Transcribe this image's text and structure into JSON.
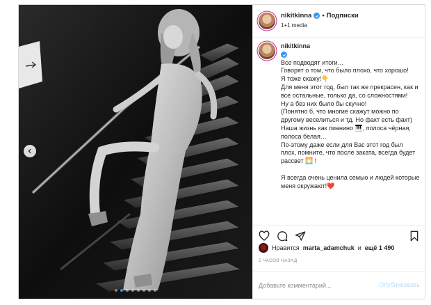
{
  "post": {
    "username": "nikitkinna",
    "follow_label": "Подписки",
    "separator": "•",
    "media_info": "1+1 media",
    "caption_lines": [
      "Все подводят итоги…",
      "Говорят о том, что было плохо, что хорошо!",
      "Я тоже скажу!👇",
      "Для меня этот год, был так же прекрасен, как и все остальные, только да, со сложностями!",
      "Ну а без них было бы скучно!",
      "(Понятно б, что многие скажут можно по другому веселиться и тд. Но факт есть факт)",
      "Наша жизнь как пианино 🎹, полоса чёрная, полоса белая…",
      "По-этому даже если для Вас этот год был плох, помните, что после заката, всегда будет рассвет 🌅 !",
      "",
      "Я всегда очень ценила семью и людей которые меня окружают!❤️"
    ],
    "likes": {
      "prefix": "Нравится",
      "liker": "marta_adamchuk",
      "conjunction": "и",
      "count_label": "ещё 1 490"
    },
    "timestamp": "2 ЧАСОВ НАЗАД",
    "comment": {
      "placeholder": "Добавьте комментарий...",
      "publish_label": "Опубликовать"
    },
    "carousel": {
      "total": 8,
      "active_index": 1
    },
    "icons": [
      "heart-icon",
      "comment-icon",
      "share-icon",
      "bookmark-icon",
      "chevron-left-icon",
      "verified-icon"
    ],
    "colors": {
      "verified": "#3897f0",
      "publish_disabled": "#b2dffc",
      "active_dot": "#3897f0"
    }
  }
}
